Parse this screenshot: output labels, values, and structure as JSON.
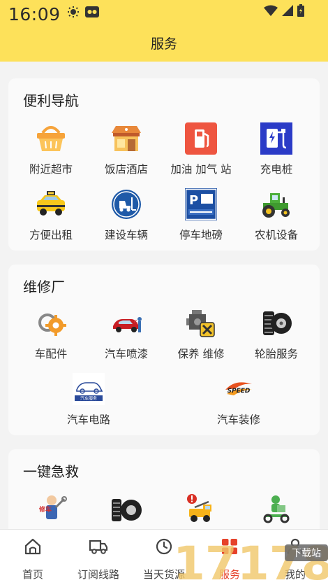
{
  "status_bar": {
    "time": "16:09"
  },
  "header": {
    "title": "服务"
  },
  "sections": [
    {
      "title": "便利导航",
      "items": [
        {
          "label": "附近超市",
          "icon": "supermarket-basket-icon"
        },
        {
          "label": "饭店酒店",
          "icon": "restaurant-shop-icon"
        },
        {
          "label": "加油 加气 站",
          "icon": "gas-station-icon"
        },
        {
          "label": "充电桩",
          "icon": "charging-pile-icon"
        },
        {
          "label": "方便出租",
          "icon": "taxi-icon"
        },
        {
          "label": "建设车辆",
          "icon": "forklift-sign-icon"
        },
        {
          "label": "停车地磅",
          "icon": "parking-scale-icon"
        },
        {
          "label": "农机设备",
          "icon": "tractor-icon"
        }
      ]
    },
    {
      "title": "维修厂",
      "items": [
        {
          "label": "车配件",
          "icon": "car-parts-gear-icon"
        },
        {
          "label": "汽车喷漆",
          "icon": "car-painting-icon"
        },
        {
          "label": "保养 维修",
          "icon": "engine-repair-icon"
        },
        {
          "label": "轮胎服务",
          "icon": "tire-icon"
        },
        {
          "label": "汽车电路",
          "icon": "car-circuit-icon",
          "badge_text": "汽车服务"
        },
        {
          "label": "汽车装修",
          "icon": "speed-logo-icon",
          "badge_text": "SPEED"
        }
      ]
    },
    {
      "title": "一键急救",
      "items": [
        {
          "label": "",
          "icon": "mechanic-icon",
          "badge_text": "修车"
        },
        {
          "label": "",
          "icon": "tire-stack-icon"
        },
        {
          "label": "",
          "icon": "tow-truck-icon"
        },
        {
          "label": "",
          "icon": "delivery-scooter-icon"
        }
      ]
    }
  ],
  "tabbar": [
    {
      "label": "首页",
      "icon": "home-icon"
    },
    {
      "label": "订阅线路",
      "icon": "truck-icon"
    },
    {
      "label": "当天货源",
      "icon": "clock-icon"
    },
    {
      "label": "服务",
      "icon": "service-grid-icon",
      "active": true
    },
    {
      "label": "我的",
      "icon": "profile-icon"
    }
  ],
  "watermark": {
    "text": "17178",
    "badge": "下载站"
  },
  "colors": {
    "header_bg": "#fde15a",
    "active_tab": "#e6422b"
  }
}
